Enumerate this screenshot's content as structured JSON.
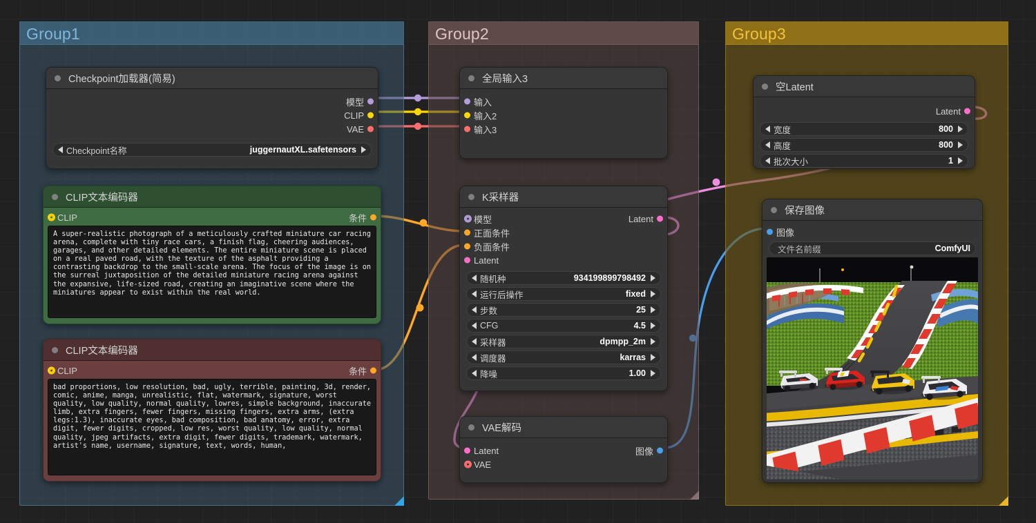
{
  "canvas": {
    "background": "#212121",
    "grid": true
  },
  "groups": [
    {
      "id": "group1",
      "title": "Group1",
      "color": "#3f5d73",
      "title_color": "#7fb8dd",
      "body_color": "rgba(58,86,106,0.55)",
      "header_color": "rgba(62,102,128,0.80)"
    },
    {
      "id": "group2",
      "title": "Group2",
      "color": "#7d6a6a",
      "title_color": "#e0c3c3",
      "body_color": "rgba(86,68,68,0.55)",
      "header_color": "rgba(104,80,80,0.80)"
    },
    {
      "id": "group3",
      "title": "Group3",
      "color": "#c69a22",
      "title_color": "#f2c23c",
      "body_color": "rgba(109,88,25,0.62)",
      "header_color": "rgba(150,116,22,0.92)"
    }
  ],
  "nodes": {
    "checkpoint_loader": {
      "title": "Checkpoint加载器(简易)",
      "outputs": [
        {
          "label": "模型",
          "color": "#b39ddb"
        },
        {
          "label": "CLIP",
          "color": "#ffd600"
        },
        {
          "label": "VAE",
          "color": "#ff6e6e"
        }
      ],
      "widgets": [
        {
          "name": "Checkpoint名称",
          "value": "juggernautXL.safetensors"
        }
      ]
    },
    "clip_positive": {
      "title": "CLIP文本编码器",
      "input": {
        "label": "CLIP",
        "color": "#ffd600"
      },
      "output": {
        "label": "条件",
        "color": "#ffa726"
      },
      "text": "A super-realistic photograph of a meticulously crafted miniature car racing arena, complete with tiny race cars, a finish flag, cheering audiences, garages, and other detailed elements. The entire miniature scene is placed on a real paved road, with the texture of the asphalt providing a contrasting backdrop to the small-scale arena. The focus of the image is on the surreal juxtaposition of the detailed miniature racing arena against the expansive, life-sized road, creating an imaginative scene where the miniatures appear to exist within the real world.",
      "accent": "#3e6b41"
    },
    "clip_negative": {
      "title": "CLIP文本编码器",
      "input": {
        "label": "CLIP",
        "color": "#ffd600"
      },
      "output": {
        "label": "条件",
        "color": "#ffa726"
      },
      "text": "bad proportions, low resolution, bad, ugly, terrible, painting, 3d, render, comic, anime, manga, unrealistic, flat, watermark, signature, worst quality, low quality, normal quality, lowres, simple background, inaccurate limb, extra fingers, fewer fingers, missing fingers, extra arms, (extra legs:1.3), inaccurate eyes, bad composition, bad anatomy, error, extra digit, fewer digits, cropped, low res, worst quality, low quality, normal quality, jpeg artifacts, extra digit, fewer digits, trademark, watermark, artist's name, username, signature, text, words, human,",
      "accent": "#6b3f3f"
    },
    "global_input3": {
      "title": "全局输入3",
      "inputs": [
        {
          "label": "输入",
          "color": "#b39ddb"
        },
        {
          "label": "输入2",
          "color": "#ffd600"
        },
        {
          "label": "输入3",
          "color": "#ff6e6e"
        }
      ]
    },
    "ksampler": {
      "title": "K采样器",
      "inputs": [
        {
          "label": "模型",
          "color": "#b39ddb",
          "connected": true
        },
        {
          "label": "正面条件",
          "color": "#ffa726",
          "connected": false
        },
        {
          "label": "负面条件",
          "color": "#ffa726",
          "connected": false
        },
        {
          "label": "Latent",
          "color": "#ff6ec7",
          "connected": false
        }
      ],
      "outputs": [
        {
          "label": "Latent",
          "color": "#ff6ec7"
        }
      ],
      "widgets": [
        {
          "name": "随机种",
          "value": "934199899798492"
        },
        {
          "name": "运行后操作",
          "value": "fixed"
        },
        {
          "name": "步数",
          "value": "25"
        },
        {
          "name": "CFG",
          "value": "4.5"
        },
        {
          "name": "采样器",
          "value": "dpmpp_2m"
        },
        {
          "name": "调度器",
          "value": "karras"
        },
        {
          "name": "降噪",
          "value": "1.00"
        }
      ]
    },
    "vae_decode": {
      "title": "VAE解码",
      "inputs": [
        {
          "label": "Latent",
          "color": "#ff6ec7",
          "connected": false
        },
        {
          "label": "VAE",
          "color": "#ff6e6e",
          "connected": true
        }
      ],
      "outputs": [
        {
          "label": "图像",
          "color": "#4a9eea"
        }
      ]
    },
    "empty_latent": {
      "title": "空Latent",
      "outputs": [
        {
          "label": "Latent",
          "color": "#ff6ec7"
        }
      ],
      "widgets": [
        {
          "name": "宽度",
          "value": "800"
        },
        {
          "name": "高度",
          "value": "800"
        },
        {
          "name": "批次大小",
          "value": "1"
        }
      ]
    },
    "save_image": {
      "title": "保存图像",
      "inputs": [
        {
          "label": "图像",
          "color": "#4a9eea"
        }
      ],
      "widgets": [
        {
          "name": "文件名前缀",
          "value": "ComfyUI"
        }
      ],
      "preview_alt": "miniature race cars on a curved track"
    }
  },
  "wires": [
    {
      "name": "model-link",
      "color": "#b39ddb"
    },
    {
      "name": "clip-link",
      "color": "#ffd600"
    },
    {
      "name": "vae-link",
      "color": "#ff6e6e"
    },
    {
      "name": "positive-cond",
      "color": "#ffa726"
    },
    {
      "name": "negative-cond",
      "color": "#ffa726"
    },
    {
      "name": "latent-link",
      "color": "#ff6ec7"
    },
    {
      "name": "latent-out",
      "color": "#ff6ec7"
    },
    {
      "name": "image-link",
      "color": "#4a9eea"
    }
  ]
}
